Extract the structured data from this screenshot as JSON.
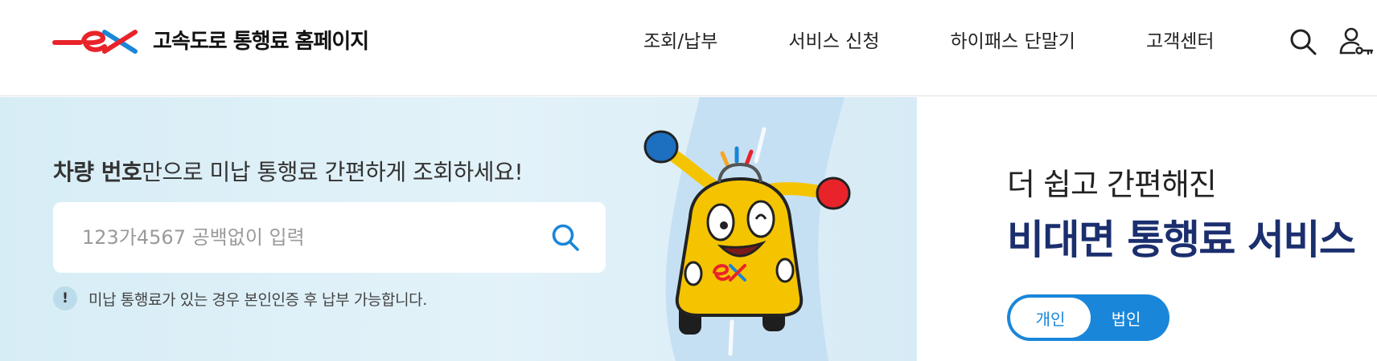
{
  "header": {
    "site_title": "고속도로 통행료 홈페이지",
    "nav": [
      "조회/납부",
      "서비스 신청",
      "하이패스 단말기",
      "고객센터"
    ]
  },
  "hero": {
    "headline_bold": "차량 번호",
    "headline_rest": "만으로 미납 통행료 간편하게 조회하세요!",
    "search_placeholder": "123가4567 공백없이 입력",
    "notice_mark": "!",
    "notice_text": "미납 통행료가 있는 경우 본인인증 후 납부 가능합니다."
  },
  "promo": {
    "subtitle": "더 쉽고 간편해진",
    "title": "비대면 통행료 서비스",
    "toggle_options": [
      "개인",
      "법인"
    ]
  },
  "colors": {
    "brand_red": "#e8232a",
    "brand_blue": "#1a86d9",
    "navy": "#1b2f6e"
  }
}
